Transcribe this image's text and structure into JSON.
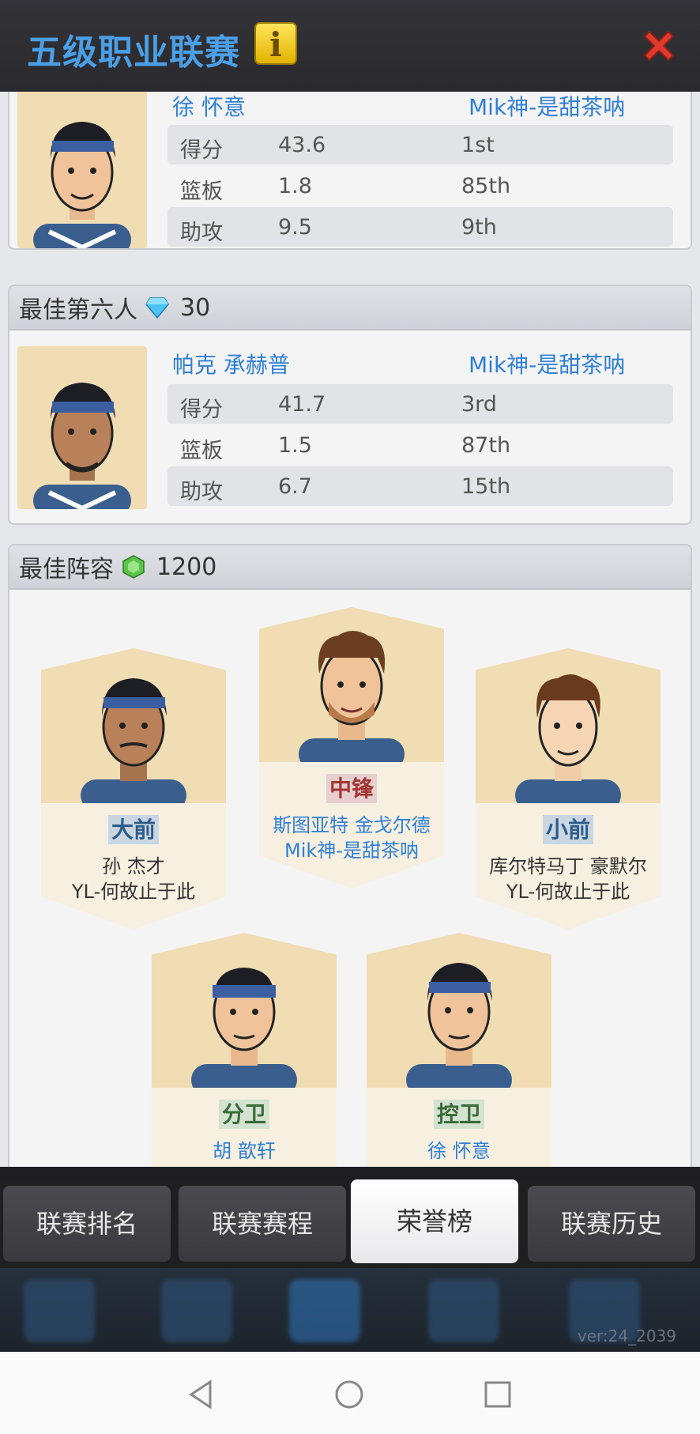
{
  "header": {
    "title": "五级职业联赛",
    "info_icon": "info-icon",
    "close_icon": "close-icon"
  },
  "mvp_partial": {
    "player_name": "徐 怀意",
    "team": "Mik神-是甜茶呐",
    "stats": [
      {
        "label": "得分",
        "value": "43.6",
        "rank": "1st"
      },
      {
        "label": "篮板",
        "value": "1.8",
        "rank": "85th"
      },
      {
        "label": "助攻",
        "value": "9.5",
        "rank": "9th"
      }
    ]
  },
  "sixth_man": {
    "title": "最佳第六人",
    "reward_icon": "diamond-icon",
    "reward": "30",
    "player_name": "帕克 承赫普",
    "team": "Mik神-是甜茶呐",
    "stats": [
      {
        "label": "得分",
        "value": "41.7",
        "rank": "3rd"
      },
      {
        "label": "篮板",
        "value": "1.5",
        "rank": "87th"
      },
      {
        "label": "助攻",
        "value": "6.7",
        "rank": "15th"
      }
    ]
  },
  "best_lineup": {
    "title": "最佳阵容",
    "reward_icon": "green-gem-icon",
    "reward": "1200",
    "cards": [
      {
        "position": "大前",
        "player": "孙 杰才",
        "team": "YL-何故止于此"
      },
      {
        "position": "中锋",
        "player": "斯图亚特 金戈尔德",
        "team": "Mik神-是甜茶呐"
      },
      {
        "position": "小前",
        "player": "库尔特马丁 豪默尔",
        "team": "YL-何故止于此"
      },
      {
        "position": "分卫",
        "player": "胡 歆轩"
      },
      {
        "position": "控卫",
        "player": "徐 怀意"
      }
    ]
  },
  "tabs": [
    "联赛排名",
    "联赛赛程",
    "荣誉榜",
    "联赛历史"
  ],
  "active_tab": "荣誉榜",
  "version": "ver:24_2039",
  "colors": {
    "accent": "#4a9fe6",
    "link": "#2f7fd6",
    "header_bg": "#2f2f33",
    "content_bg": "#e6e7ea"
  }
}
